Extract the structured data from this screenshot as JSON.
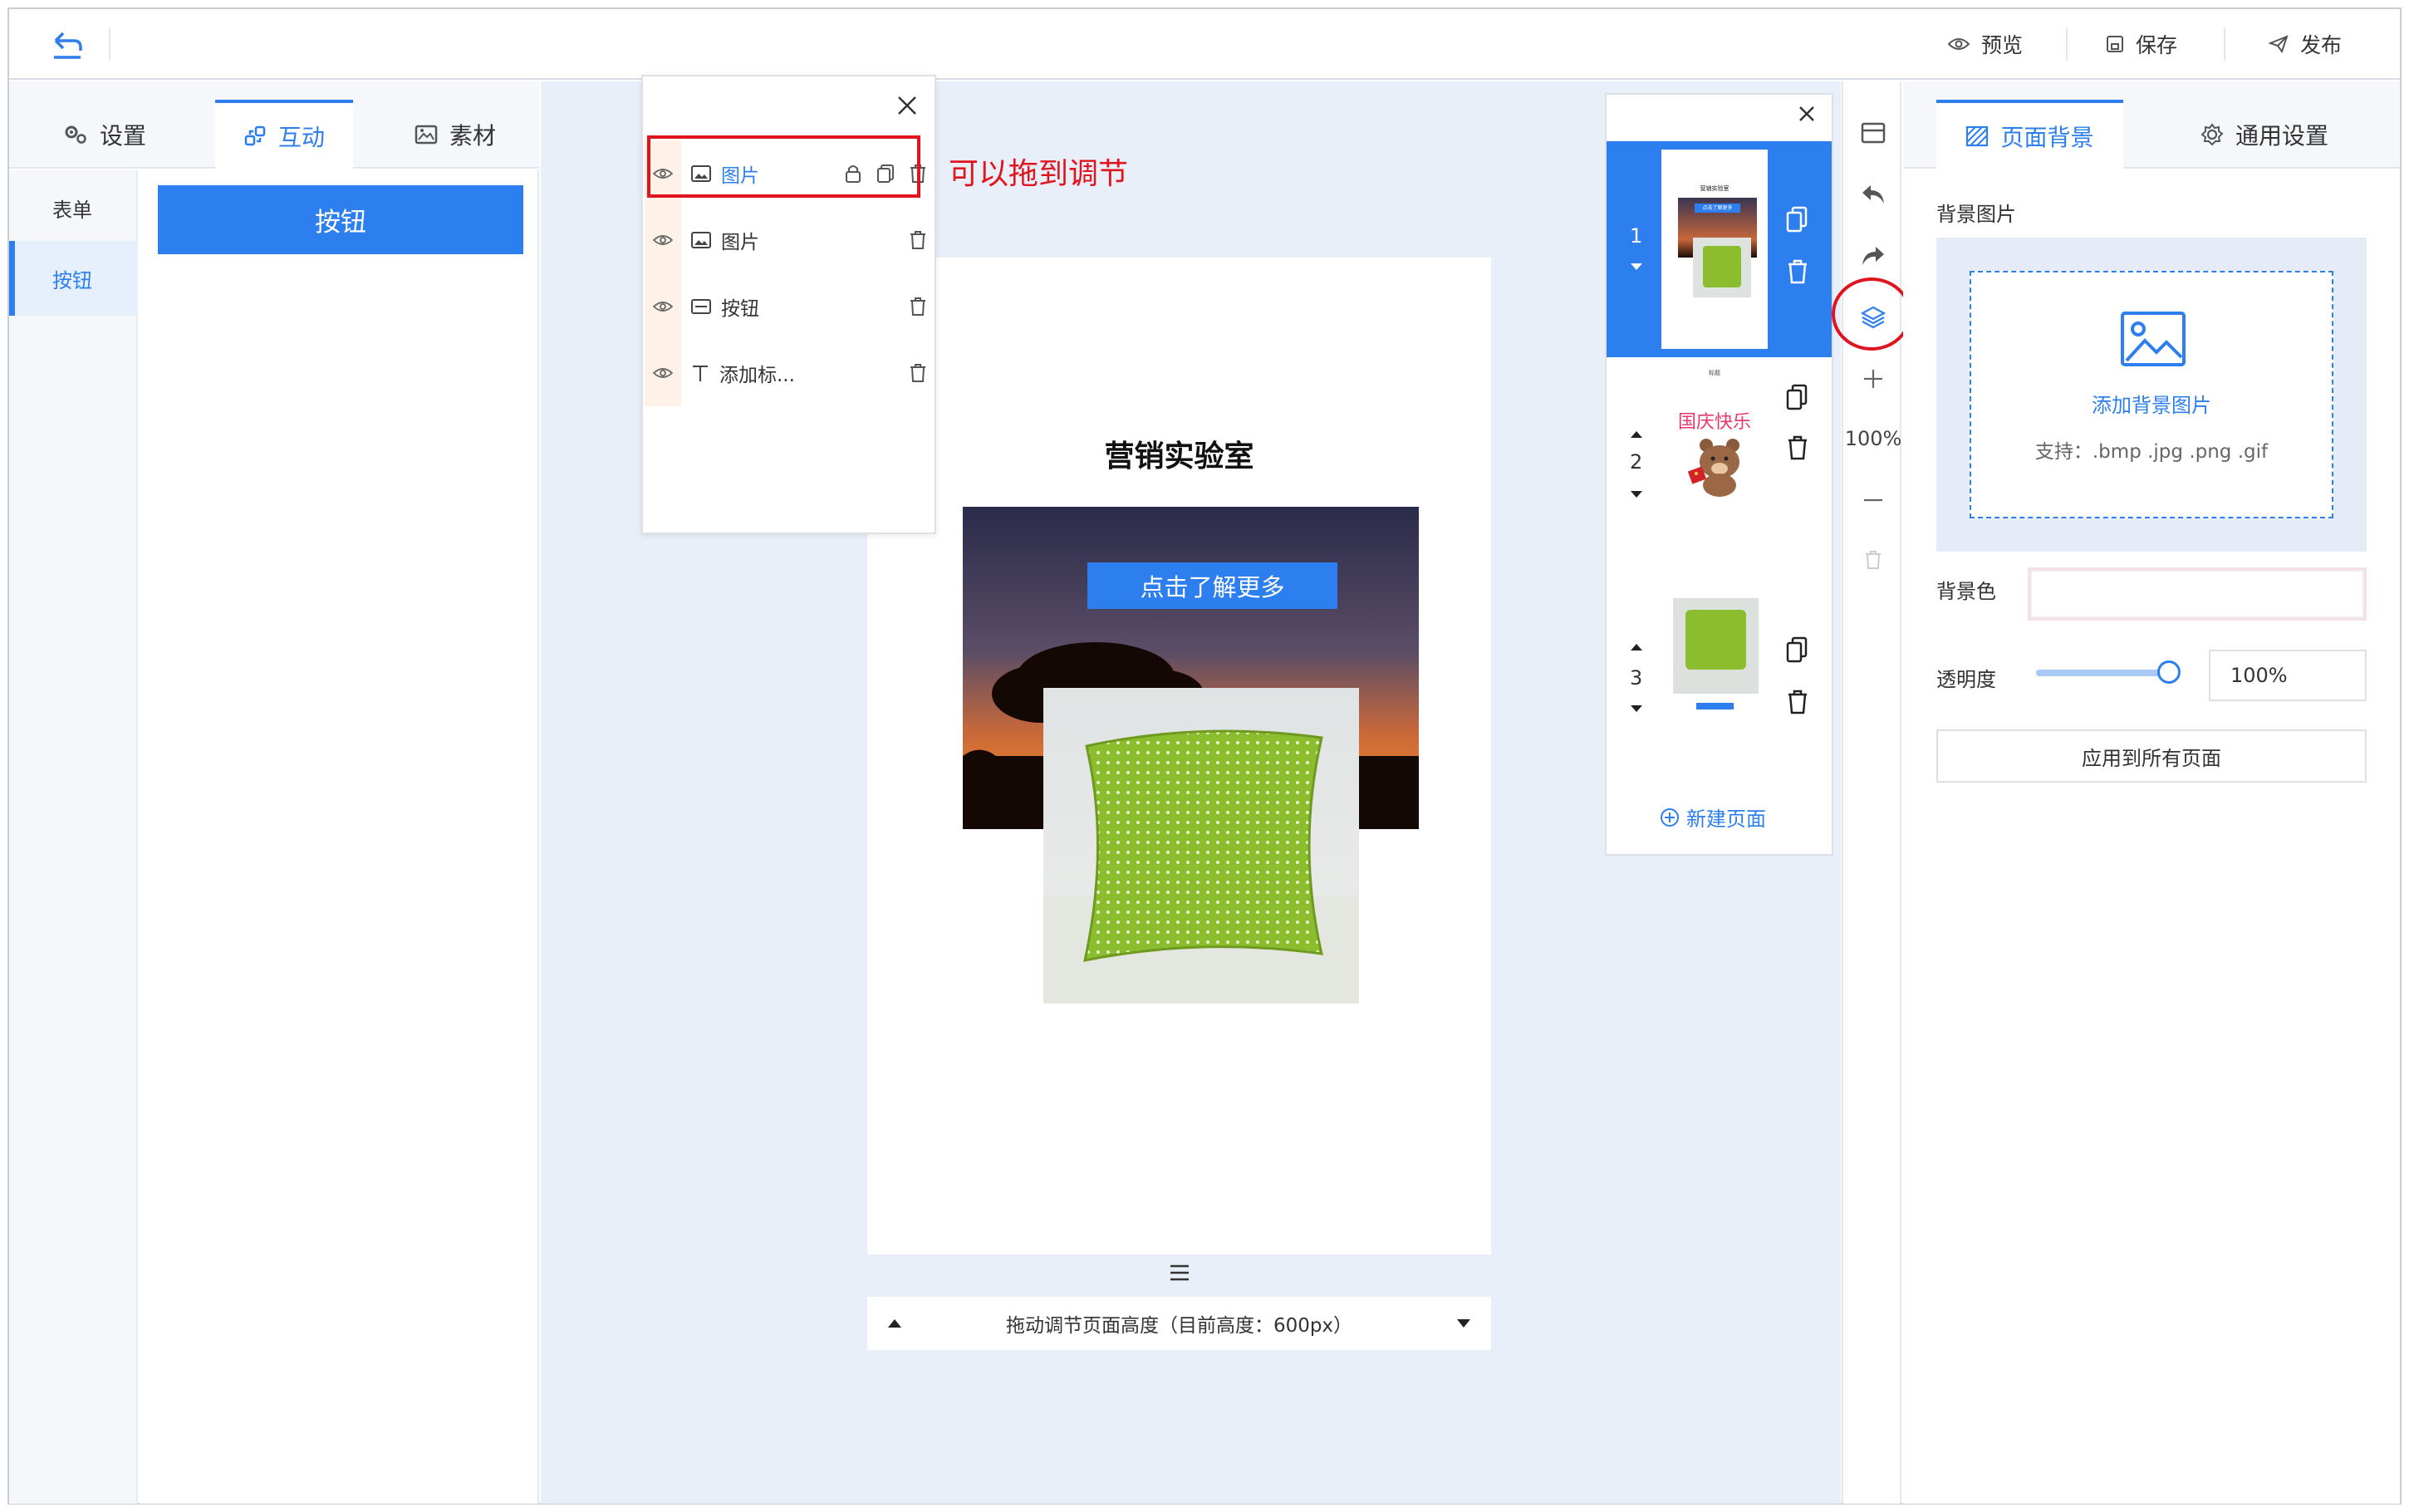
{
  "topbar": {
    "preview_label": "预览",
    "save_label": "保存",
    "publish_label": "发布"
  },
  "left_panel": {
    "tabs": [
      "设置",
      "互动",
      "素材"
    ],
    "active_tab": "互动",
    "nav": [
      "表单",
      "按钮"
    ],
    "active_nav": "按钮",
    "button_widget_label": "按钮"
  },
  "layers_panel": {
    "rows": [
      {
        "type": "image",
        "label": "图片",
        "selected": true
      },
      {
        "type": "image",
        "label": "图片",
        "selected": false
      },
      {
        "type": "button",
        "label": "按钮",
        "selected": false
      },
      {
        "type": "text",
        "label": "添加标...",
        "selected": false
      }
    ],
    "annotation": "可以拖到调节"
  },
  "canvas": {
    "page_title": "营销实验室",
    "cta_button": "点击了解更多",
    "height_bar_label": "拖动调节页面高度（目前高度：600px）"
  },
  "pages_panel": {
    "pages": [
      {
        "number": "1",
        "thumb_title": "营销实验室",
        "thumb_button": "点击了解更多",
        "active": true
      },
      {
        "number": "2",
        "thumb_caption": "标题",
        "thumb_text": "国庆快乐",
        "active": false
      },
      {
        "number": "3",
        "active": false
      }
    ],
    "new_page_label": "新建页面"
  },
  "toolbar": {
    "zoom": "100%"
  },
  "right_panel": {
    "tabs": [
      "页面背景",
      "通用设置"
    ],
    "active_tab": "页面背景",
    "bg_image_label": "背景图片",
    "add_bg_label": "添加背景图片",
    "support_text": "支持：.bmp .jpg .png .gif",
    "bg_color_label": "背景色",
    "opacity_label": "透明度",
    "opacity_value": "100%",
    "opacity_level": 1.0,
    "apply_all_label": "应用到所有页面"
  },
  "colors": {
    "accent": "#2d7ff0",
    "annotation_red": "#e0141e",
    "canvas_bg": "#e9eff9"
  }
}
